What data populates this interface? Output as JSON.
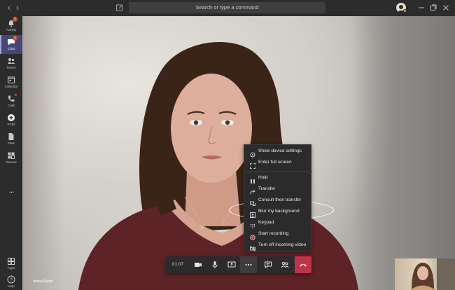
{
  "titlebar": {
    "search_placeholder": "Search or type a command"
  },
  "rail": {
    "items": [
      {
        "label": "Activity",
        "icon": "bell-icon",
        "badge": "1"
      },
      {
        "label": "Chat",
        "icon": "chat-icon",
        "badge": "1",
        "active": true
      },
      {
        "label": "Teams",
        "icon": "teams-icon"
      },
      {
        "label": "Calendar",
        "icon": "calendar-icon"
      },
      {
        "label": "Calls",
        "icon": "phone-icon",
        "dot": true
      },
      {
        "label": "Pickit",
        "icon": "pickit-icon"
      },
      {
        "label": "Files",
        "icon": "files-icon"
      },
      {
        "label": "Planner",
        "icon": "planner-icon"
      }
    ],
    "more_label": "...",
    "bottom": [
      {
        "label": "Apps",
        "icon": "apps-icon"
      },
      {
        "label": "Help",
        "icon": "help-icon"
      }
    ]
  },
  "menu": {
    "items": [
      {
        "label": "Show device settings",
        "icon": "gear-icon"
      },
      {
        "label": "Enter full screen",
        "icon": "fullscreen-icon"
      },
      {
        "label": "Hold",
        "icon": "hold-icon"
      },
      {
        "label": "Transfer",
        "icon": "transfer-icon"
      },
      {
        "label": "Consult then transfer",
        "icon": "consult-transfer-icon"
      },
      {
        "label": "Blur my background",
        "icon": "blur-background-icon"
      },
      {
        "label": "Keypad",
        "icon": "keypad-icon"
      },
      {
        "label": "Start recording",
        "icon": "record-icon"
      },
      {
        "label": "Turn off incoming video",
        "icon": "video-off-icon"
      }
    ]
  },
  "callbar": {
    "timer": "01:07"
  },
  "participant": {
    "name": "Ioana Marin"
  },
  "colors": {
    "rail_bg": "#2d2c2c",
    "accent": "#464775",
    "badge": "#cc4a31",
    "hangup": "#c4314b",
    "menu_bg": "#2b2b2b"
  }
}
